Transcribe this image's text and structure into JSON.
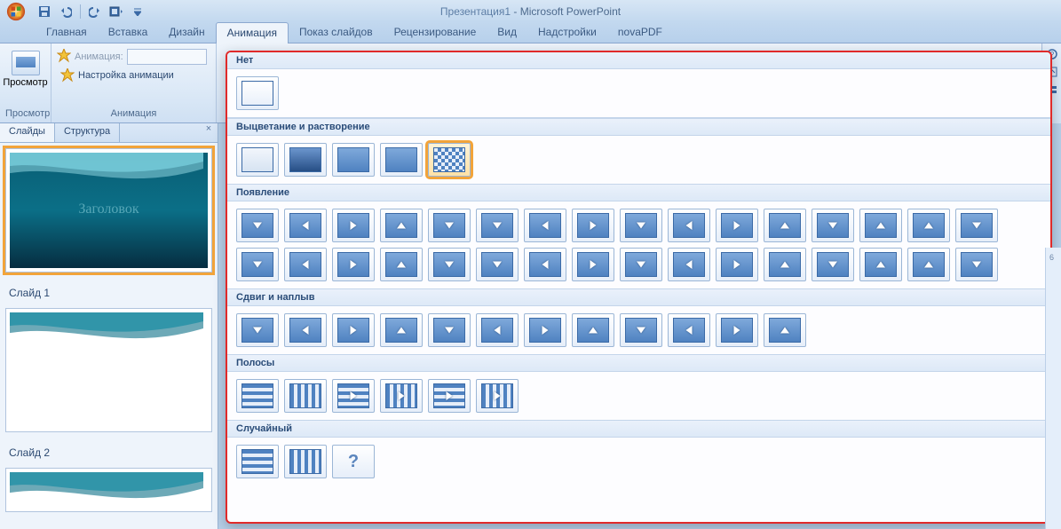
{
  "title": {
    "doc": "Презентация1",
    "app": "Microsoft PowerPoint"
  },
  "qat": {
    "save": "save",
    "undo": "undo",
    "redo": "redo",
    "paste_special": "paste"
  },
  "tabs": {
    "home": "Главная",
    "insert": "Вставка",
    "design": "Дизайн",
    "animation": "Анимация",
    "slideshow": "Показ слайдов",
    "review": "Рецензирование",
    "view": "Вид",
    "addins": "Надстройки",
    "novapdf": "novaPDF"
  },
  "ribbon": {
    "preview_group": "Просмотр",
    "preview_btn": "Просмотр",
    "anim_group": "Анимация",
    "anim_label": "Анимация:",
    "custom_anim": "Настройка анимации"
  },
  "panel": {
    "tab_slides": "Слайды",
    "tab_outline": "Структура",
    "close": "×",
    "slide1_title": "Заголовок",
    "slide1_label": "Слайд 1",
    "slide2_label": "Слайд 2"
  },
  "gallery": {
    "none_header": "Нет",
    "fade_header": "Выцветание и растворение",
    "appear_header": "Появление",
    "push_header": "Сдвиг и наплыв",
    "stripes_header": "Полосы",
    "random_header": "Случайный",
    "none_items": 1,
    "fade_items": 5,
    "appear_row1": 16,
    "appear_row2": 16,
    "push_items": 12,
    "stripes_items": 6,
    "random_items": 3,
    "selected_fade_index": 4
  },
  "ruler_tick": "6"
}
